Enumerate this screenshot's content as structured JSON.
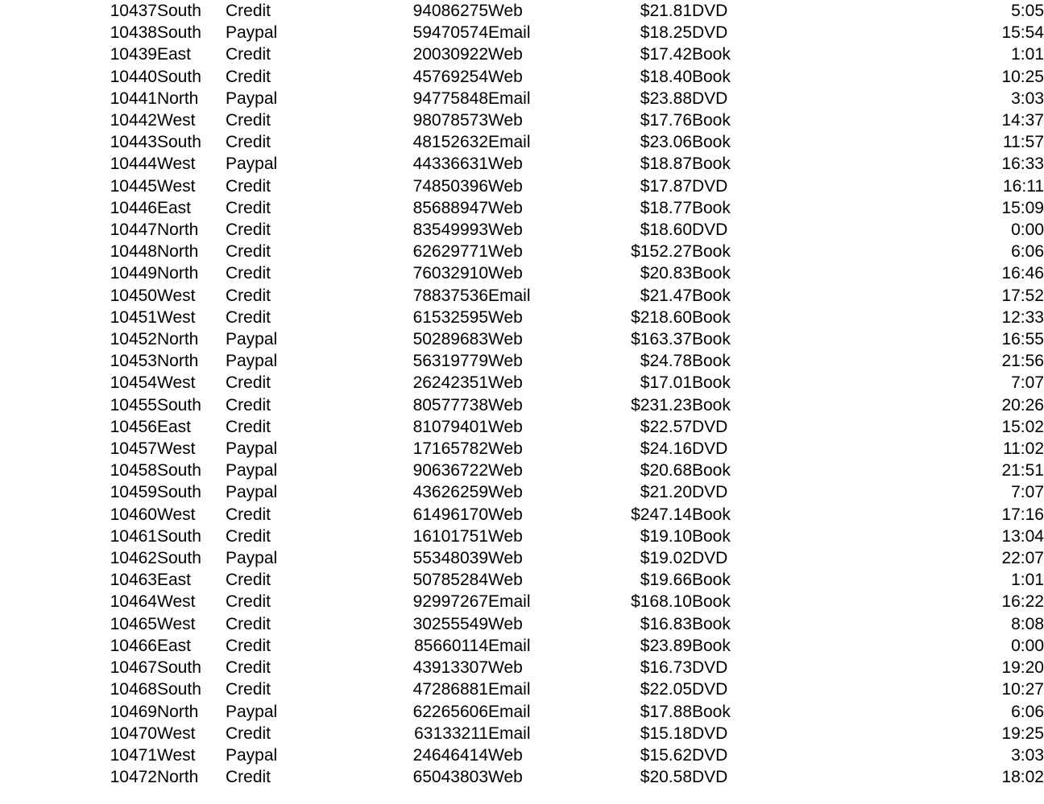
{
  "table": {
    "columns": [
      {
        "key": "id",
        "align": "right"
      },
      {
        "key": "region",
        "align": "left"
      },
      {
        "key": "payment",
        "align": "left"
      },
      {
        "key": "order",
        "align": "right"
      },
      {
        "key": "channel",
        "align": "left"
      },
      {
        "key": "amount",
        "align": "right"
      },
      {
        "key": "product",
        "align": "left"
      },
      {
        "key": "time",
        "align": "right"
      }
    ],
    "rows": [
      {
        "id": "10437",
        "region": "South",
        "payment": "Credit",
        "order": "94086275",
        "channel": "Web",
        "amount": "$21.81",
        "product": "DVD",
        "time": "5:05"
      },
      {
        "id": "10438",
        "region": "South",
        "payment": "Paypal",
        "order": "59470574",
        "channel": "Email",
        "amount": "$18.25",
        "product": "DVD",
        "time": "15:54"
      },
      {
        "id": "10439",
        "region": "East",
        "payment": "Credit",
        "order": "20030922",
        "channel": "Web",
        "amount": "$17.42",
        "product": "Book",
        "time": "1:01"
      },
      {
        "id": "10440",
        "region": "South",
        "payment": "Credit",
        "order": "45769254",
        "channel": "Web",
        "amount": "$18.40",
        "product": "Book",
        "time": "10:25"
      },
      {
        "id": "10441",
        "region": "North",
        "payment": "Paypal",
        "order": "94775848",
        "channel": "Email",
        "amount": "$23.88",
        "product": "DVD",
        "time": "3:03"
      },
      {
        "id": "10442",
        "region": "West",
        "payment": "Credit",
        "order": "98078573",
        "channel": "Web",
        "amount": "$17.76",
        "product": "Book",
        "time": "14:37"
      },
      {
        "id": "10443",
        "region": "South",
        "payment": "Credit",
        "order": "48152632",
        "channel": "Email",
        "amount": "$23.06",
        "product": "Book",
        "time": "11:57"
      },
      {
        "id": "10444",
        "region": "West",
        "payment": "Paypal",
        "order": "44336631",
        "channel": "Web",
        "amount": "$18.87",
        "product": "Book",
        "time": "16:33"
      },
      {
        "id": "10445",
        "region": "West",
        "payment": "Credit",
        "order": "74850396",
        "channel": "Web",
        "amount": "$17.87",
        "product": "DVD",
        "time": "16:11"
      },
      {
        "id": "10446",
        "region": "East",
        "payment": "Credit",
        "order": "85688947",
        "channel": "Web",
        "amount": "$18.77",
        "product": "Book",
        "time": "15:09"
      },
      {
        "id": "10447",
        "region": "North",
        "payment": "Credit",
        "order": "83549993",
        "channel": "Web",
        "amount": "$18.60",
        "product": "DVD",
        "time": "0:00"
      },
      {
        "id": "10448",
        "region": "North",
        "payment": "Credit",
        "order": "62629771",
        "channel": "Web",
        "amount": "$152.27",
        "product": "Book",
        "time": "6:06"
      },
      {
        "id": "10449",
        "region": "North",
        "payment": "Credit",
        "order": "76032910",
        "channel": "Web",
        "amount": "$20.83",
        "product": "Book",
        "time": "16:46"
      },
      {
        "id": "10450",
        "region": "West",
        "payment": "Credit",
        "order": "78837536",
        "channel": "Email",
        "amount": "$21.47",
        "product": "Book",
        "time": "17:52"
      },
      {
        "id": "10451",
        "region": "West",
        "payment": "Credit",
        "order": "61532595",
        "channel": "Web",
        "amount": "$218.60",
        "product": "Book",
        "time": "12:33"
      },
      {
        "id": "10452",
        "region": "North",
        "payment": "Paypal",
        "order": "50289683",
        "channel": "Web",
        "amount": "$163.37",
        "product": "Book",
        "time": "16:55"
      },
      {
        "id": "10453",
        "region": "North",
        "payment": "Paypal",
        "order": "56319779",
        "channel": "Web",
        "amount": "$24.78",
        "product": "Book",
        "time": "21:56"
      },
      {
        "id": "10454",
        "region": "West",
        "payment": "Credit",
        "order": "26242351",
        "channel": "Web",
        "amount": "$17.01",
        "product": "Book",
        "time": "7:07"
      },
      {
        "id": "10455",
        "region": "South",
        "payment": "Credit",
        "order": "80577738",
        "channel": "Web",
        "amount": "$231.23",
        "product": "Book",
        "time": "20:26"
      },
      {
        "id": "10456",
        "region": "East",
        "payment": "Credit",
        "order": "81079401",
        "channel": "Web",
        "amount": "$22.57",
        "product": "DVD",
        "time": "15:02"
      },
      {
        "id": "10457",
        "region": "West",
        "payment": "Paypal",
        "order": "17165782",
        "channel": "Web",
        "amount": "$24.16",
        "product": "DVD",
        "time": "11:02"
      },
      {
        "id": "10458",
        "region": "South",
        "payment": "Paypal",
        "order": "90636722",
        "channel": "Web",
        "amount": "$20.68",
        "product": "Book",
        "time": "21:51"
      },
      {
        "id": "10459",
        "region": "South",
        "payment": "Paypal",
        "order": "43626259",
        "channel": "Web",
        "amount": "$21.20",
        "product": "DVD",
        "time": "7:07"
      },
      {
        "id": "10460",
        "region": "West",
        "payment": "Credit",
        "order": "61496170",
        "channel": "Web",
        "amount": "$247.14",
        "product": "Book",
        "time": "17:16"
      },
      {
        "id": "10461",
        "region": "South",
        "payment": "Credit",
        "order": "16101751",
        "channel": "Web",
        "amount": "$19.10",
        "product": "Book",
        "time": "13:04"
      },
      {
        "id": "10462",
        "region": "South",
        "payment": "Paypal",
        "order": "55348039",
        "channel": "Web",
        "amount": "$19.02",
        "product": "DVD",
        "time": "22:07"
      },
      {
        "id": "10463",
        "region": "East",
        "payment": "Credit",
        "order": "50785284",
        "channel": "Web",
        "amount": "$19.66",
        "product": "Book",
        "time": "1:01"
      },
      {
        "id": "10464",
        "region": "West",
        "payment": "Credit",
        "order": "92997267",
        "channel": "Email",
        "amount": "$168.10",
        "product": "Book",
        "time": "16:22"
      },
      {
        "id": "10465",
        "region": "West",
        "payment": "Credit",
        "order": "30255549",
        "channel": "Web",
        "amount": "$16.83",
        "product": "Book",
        "time": "8:08"
      },
      {
        "id": "10466",
        "region": "East",
        "payment": "Credit",
        "order": "85660114",
        "channel": "Email",
        "amount": "$23.89",
        "product": "Book",
        "time": "0:00"
      },
      {
        "id": "10467",
        "region": "South",
        "payment": "Credit",
        "order": "43913307",
        "channel": "Web",
        "amount": "$16.73",
        "product": "DVD",
        "time": "19:20"
      },
      {
        "id": "10468",
        "region": "South",
        "payment": "Credit",
        "order": "47286881",
        "channel": "Email",
        "amount": "$22.05",
        "product": "DVD",
        "time": "10:27"
      },
      {
        "id": "10469",
        "region": "North",
        "payment": "Paypal",
        "order": "62265606",
        "channel": "Email",
        "amount": "$17.88",
        "product": "Book",
        "time": "6:06"
      },
      {
        "id": "10470",
        "region": "West",
        "payment": "Credit",
        "order": "63133211",
        "channel": "Email",
        "amount": "$15.18",
        "product": "DVD",
        "time": "19:25"
      },
      {
        "id": "10471",
        "region": "West",
        "payment": "Paypal",
        "order": "24646414",
        "channel": "Web",
        "amount": "$15.62",
        "product": "DVD",
        "time": "3:03"
      },
      {
        "id": "10472",
        "region": "North",
        "payment": "Credit",
        "order": "65043803",
        "channel": "Web",
        "amount": "$20.58",
        "product": "DVD",
        "time": "18:02"
      }
    ]
  }
}
